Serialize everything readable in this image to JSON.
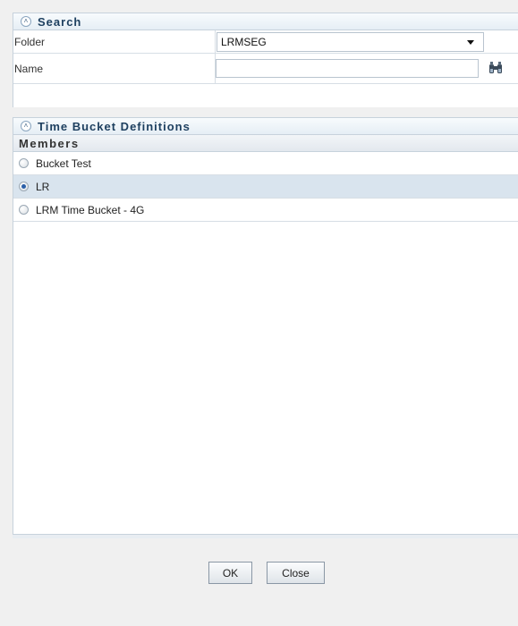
{
  "search": {
    "title": "Search",
    "folder_label": "Folder",
    "folder_value": "LRMSEG",
    "name_label": "Name",
    "name_value": "",
    "name_placeholder": ""
  },
  "definitions": {
    "title": "Time Bucket Definitions",
    "members_header": "Members",
    "members": [
      {
        "label": "Bucket Test",
        "checked": false
      },
      {
        "label": "LR",
        "checked": true
      },
      {
        "label": "LRM Time Bucket - 4G",
        "checked": false
      }
    ]
  },
  "buttons": {
    "ok_label": "OK",
    "close_label": "Close"
  }
}
